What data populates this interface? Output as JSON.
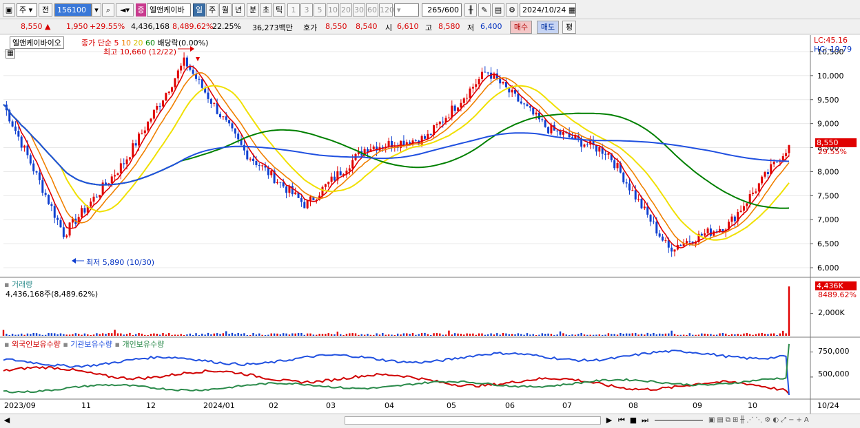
{
  "toolbar": {
    "period_value": "주",
    "period_label": "전",
    "stock_code": "156100",
    "stock_name": "엘앤케이바",
    "badge": "증",
    "timeframes": [
      "일",
      "주",
      "월",
      "년",
      "분",
      "초",
      "틱"
    ],
    "selected_timeframe": "일",
    "intervals": [
      "1",
      "3",
      "5",
      "10",
      "20",
      "30",
      "60",
      "120"
    ],
    "count": "265",
    "count_max": "/600",
    "date": "2024/10/24"
  },
  "quote": {
    "price": "8,550",
    "change": "1,950",
    "change_rate": "+29.55%",
    "volume": "4,436,168",
    "volume_rate": "8,489.62%",
    "turnover_rate": "22.25%",
    "amount": "36,273백만",
    "ask_label": "호가",
    "ask1": "8,550",
    "ask2": "8,540",
    "open_label": "시",
    "open": "6,610",
    "high_label": "고",
    "high": "8,580",
    "low_label": "저",
    "low": "6,400",
    "buy_label": "매수",
    "sell_label": "매도",
    "eval_label": "평"
  },
  "price_panel": {
    "stock_tag": "엘앤케이바이오",
    "legend_prefix": "종가 단순",
    "ma_labels": [
      "5",
      "10",
      "20",
      "60"
    ],
    "ma_colors": [
      "#e00000",
      "#f08000",
      "#f0e000",
      "#008000"
    ],
    "long_ma_color": "#2050e0",
    "extra_label": "배당락(0.00%)",
    "max_label": "최고 10,660 (12/22)",
    "min_label": "최저 5,890 (10/30)",
    "lc_label": "LC:45.16",
    "hc_label": "HC:-19.79",
    "last_price_label": "8,550",
    "last_rate_label": "29.55%",
    "y_ticks": [
      "10,500",
      "10,000",
      "9,500",
      "9,000",
      "8,500",
      "8,000",
      "7,500",
      "7,000",
      "6,500",
      "6,000"
    ]
  },
  "volume_panel": {
    "title": "거래량",
    "value_label": "4,436,168주(8,489.62%)",
    "last_label": "4,436K",
    "last_rate": "8489.62%",
    "y_tick": "2,000K"
  },
  "holdings_panel": {
    "series_labels": [
      "외국인보유수량",
      "기관보유수량",
      "개인보유수량"
    ],
    "series_colors": [
      "#d00000",
      "#2050e0",
      "#2a8a4a"
    ],
    "y_ticks": [
      "750,000",
      "500,000"
    ]
  },
  "x_labels": [
    "2023/09",
    "11",
    "12",
    "2024/01",
    "02",
    "03",
    "04",
    "05",
    "06",
    "07",
    "08",
    "09",
    "10",
    "10/24"
  ],
  "chart_data": {
    "type": "line",
    "x": [
      "2023/09",
      "11",
      "12",
      "2024/01",
      "02",
      "03",
      "04",
      "05",
      "06",
      "07",
      "08",
      "09",
      "10",
      "10/24"
    ],
    "series": [
      {
        "name": "종가",
        "values": [
          9400,
          6700,
          8200,
          10300,
          8400,
          7300,
          8500,
          8700,
          10100,
          8900,
          8400,
          6400,
          6900,
          8550
        ]
      },
      {
        "name": "거래량",
        "values": [
          150000,
          300000,
          250000,
          400000,
          180000,
          120000,
          200000,
          150000,
          300000,
          150000,
          150000,
          200000,
          150000,
          4436168
        ]
      }
    ],
    "ylim": [
      5800,
      10700
    ],
    "high": 10660,
    "low": 5890,
    "last": 8550
  }
}
